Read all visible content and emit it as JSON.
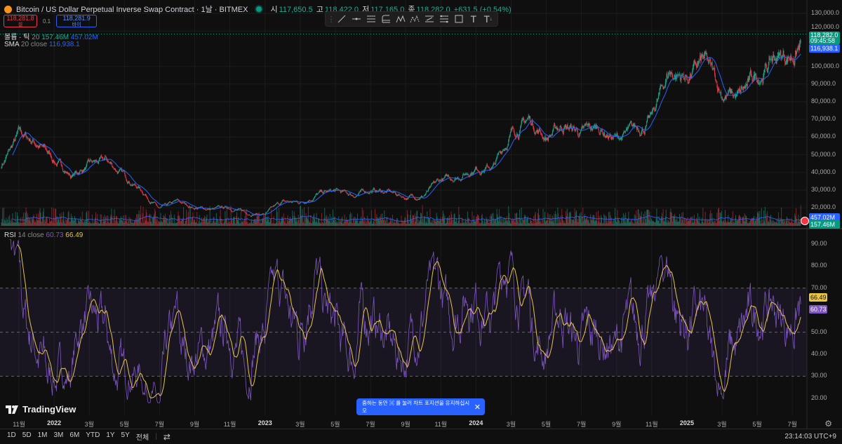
{
  "header": {
    "title": "Bitcoin / US Dollar Perpetual Inverse Swap Contract · 1날 · BITMEX",
    "open_label": "시",
    "open": "117,650.5",
    "high_label": "고",
    "high": "118,422.0",
    "low_label": "저",
    "low": "117,165.0",
    "close_label": "종",
    "close": "118,282.0",
    "change": "+631.5 (+0.54%)"
  },
  "trade": {
    "sell_price": "118,281.8",
    "sell_label": "셀",
    "spread": "0.1",
    "buy_price": "118,281.9",
    "buy_label": "바이"
  },
  "indicators": {
    "volume": {
      "name": "볼륨 · 틱",
      "param": "20",
      "v1": "157.46M",
      "v2": "457.02M"
    },
    "sma": {
      "name": "SMA",
      "param": "20 close",
      "value": "116,938.1"
    },
    "rsi": {
      "name": "RSI",
      "param": "14 close",
      "value": "60.73",
      "ma": "66.49"
    }
  },
  "price_axis": [
    "130,000.0",
    "120,000.0",
    "100,000.0",
    "90,000.0",
    "80,000.0",
    "70,000.0",
    "60,000.0",
    "50,000.0",
    "40,000.0",
    "30,000.0",
    "20,000.0"
  ],
  "price_tags": {
    "last": "118,282.0",
    "countdown": "09:45:58",
    "sma": "116,938.1",
    "vol_ma": "457.02M",
    "vol": "157.46M"
  },
  "rsi_axis": [
    "90.00",
    "80.00",
    "70.00",
    "60.00",
    "50.00",
    "40.00",
    "30.00",
    "20.00"
  ],
  "time_axis": [
    "11월",
    "2022",
    "3월",
    "5월",
    "7월",
    "9월",
    "11월",
    "2023",
    "3월",
    "5월",
    "7월",
    "9월",
    "11월",
    "2024",
    "3월",
    "5월",
    "7월",
    "9월",
    "11월",
    "2025",
    "3월",
    "5월",
    "7월"
  ],
  "ranges": [
    "1D",
    "5D",
    "1M",
    "3M",
    "6M",
    "YTD",
    "1Y",
    "5Y",
    "전체"
  ],
  "clock": "23:14:03 UTC+9",
  "toast": "줌하는 동안 ⌘ 를 눌러 차트 포지션을 유지하십시오",
  "logo": "TradingView",
  "colors": {
    "up": "#22ab94",
    "down": "#f23645",
    "sma": "#2962ff",
    "rsi": "#7e57c2",
    "rsi_ma": "#e8c547"
  },
  "chart_data": {
    "type": "candlestick",
    "start": "2021-10",
    "monthly_close_approx_k": [
      44,
      61,
      57,
      47,
      38,
      44,
      46,
      38,
      30,
      19,
      23,
      20,
      19,
      20,
      17,
      16.5,
      23,
      23,
      28,
      29,
      27,
      30,
      29,
      26,
      27,
      35,
      38,
      43,
      43,
      62,
      70,
      60,
      67,
      62,
      65,
      59,
      63,
      70,
      97,
      94,
      102,
      85,
      82,
      94,
      105,
      107,
      118.3
    ],
    "ylim": [
      15000,
      135000
    ],
    "rsi_ylim": [
      15,
      95
    ]
  }
}
